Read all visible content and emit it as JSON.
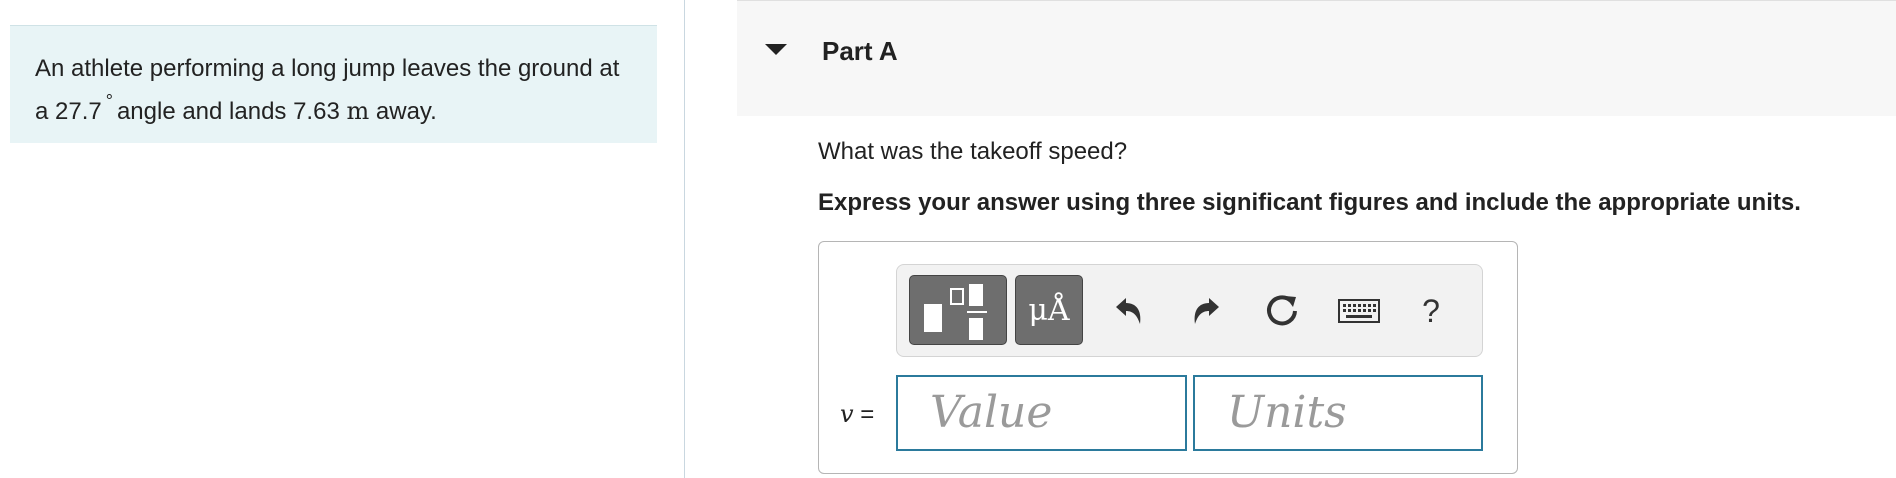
{
  "problem": {
    "text_before": "An athlete performing a long jump leaves the ground at a 27.7",
    "degree_symbol": "°",
    "text_middle": "angle and lands 7.63",
    "unit": "m",
    "text_after": "away."
  },
  "part": {
    "title": "Part A",
    "question": "What was the takeoff speed?",
    "instruction": "Express your answer using three significant figures and include the appropriate units."
  },
  "toolbar": {
    "templates_icon": "templates-icon",
    "symbols_label": "μÅ",
    "undo_icon": "undo-icon",
    "redo_icon": "redo-icon",
    "reset_icon": "reset-icon",
    "keyboard_icon": "keyboard-icon",
    "help_label": "?"
  },
  "answer": {
    "variable": "v",
    "equals": "=",
    "value_placeholder": "Value",
    "units_placeholder": "Units"
  },
  "colors": {
    "problem_bg": "#e8f4f6",
    "input_border": "#2b7a9c",
    "tool_dark": "#6e6e6e"
  }
}
